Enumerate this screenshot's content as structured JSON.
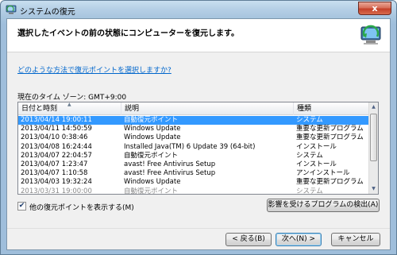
{
  "window": {
    "title": "システムの復元",
    "close_glyph": "x"
  },
  "header": {
    "text": "選択したイベントの前の状態にコンピューターを復元します。",
    "icon": "system-restore-icon"
  },
  "help_link": "どのような方法で復元ポイントを選択しますか?",
  "timezone_label": "現在のタイム ゾーン: GMT+9:00",
  "table": {
    "columns": [
      "日付と時刻",
      "説明",
      "種類"
    ],
    "rows": [
      {
        "date": "2013/04/14 19:00:11",
        "desc": "自動復元ポイント",
        "type": "システム",
        "selected": true
      },
      {
        "date": "2013/04/11 14:50:59",
        "desc": "Windows Update",
        "type": "重要な更新プログラム",
        "selected": false
      },
      {
        "date": "2013/04/10 0:38:46",
        "desc": "Windows Update",
        "type": "重要な更新プログラム",
        "selected": false
      },
      {
        "date": "2013/04/08 16:24:44",
        "desc": "Installed Java(TM) 6 Update 39 (64-bit)",
        "type": "インストール",
        "selected": false
      },
      {
        "date": "2013/04/07 22:04:57",
        "desc": "自動復元ポイント",
        "type": "システム",
        "selected": false
      },
      {
        "date": "2013/04/07 1:23:47",
        "desc": "avast! Free Antivirus Setup",
        "type": "インストール",
        "selected": false
      },
      {
        "date": "2013/04/07 1:10:58",
        "desc": "avast! Free Antivirus Setup",
        "type": "アンインストール",
        "selected": false
      },
      {
        "date": "2013/04/03 19:32:24",
        "desc": "Windows Update",
        "type": "重要な更新プログラム",
        "selected": false
      },
      {
        "date": "2013/03/31 19:00:00",
        "desc": "自動復元ポイント",
        "type": "システム",
        "selected": false
      }
    ]
  },
  "show_more_checkbox": {
    "label": "他の復元ポイントを表示する(M)",
    "checked": true,
    "check_glyph": "✔"
  },
  "buttons": {
    "scan": "影響を受けるプログラムの検出(A)",
    "back": "< 戻る(B)",
    "next": "次へ(N) >",
    "cancel": "キャンセル"
  },
  "colors": {
    "selection": "#3399ff",
    "link": "#0066cc",
    "close": "#c4412a"
  }
}
